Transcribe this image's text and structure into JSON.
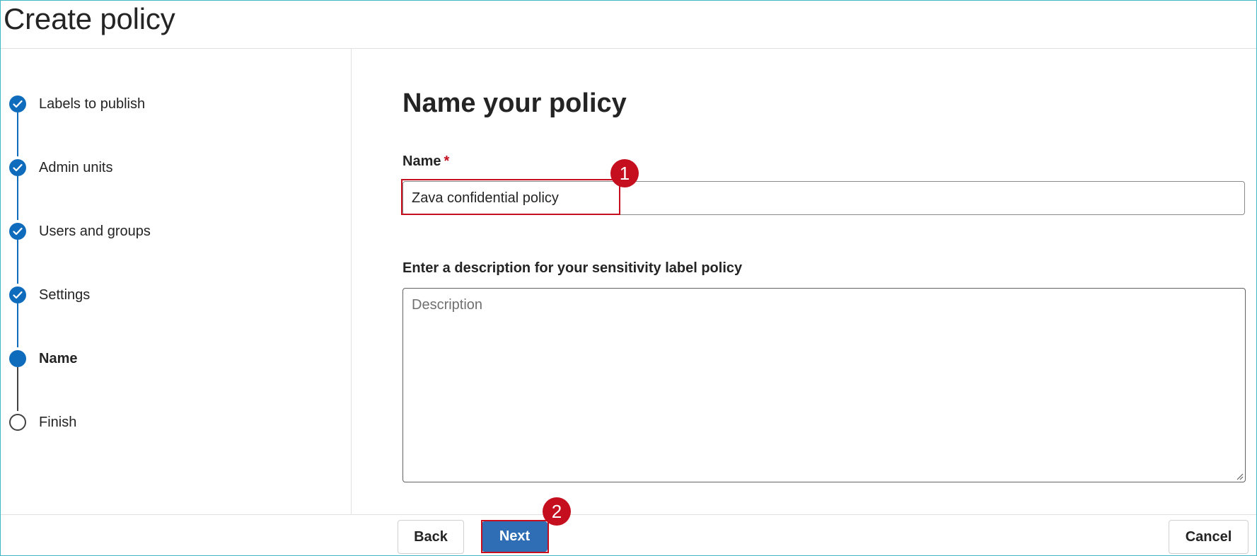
{
  "header": {
    "title": "Create policy"
  },
  "stepper": {
    "steps": [
      {
        "label": "Labels to publish",
        "state": "completed"
      },
      {
        "label": "Admin units",
        "state": "completed"
      },
      {
        "label": "Users and groups",
        "state": "completed"
      },
      {
        "label": "Settings",
        "state": "completed"
      },
      {
        "label": "Name",
        "state": "current"
      },
      {
        "label": "Finish",
        "state": "pending"
      }
    ]
  },
  "main": {
    "heading": "Name your policy",
    "name_field": {
      "label": "Name",
      "required_marker": "*",
      "value": "Zava confidential policy"
    },
    "description_field": {
      "label": "Enter a description for your sensitivity label policy",
      "placeholder": "Description",
      "value": ""
    }
  },
  "annotations": {
    "badge_1": "1",
    "badge_2": "2"
  },
  "footer": {
    "back_label": "Back",
    "next_label": "Next",
    "cancel_label": "Cancel"
  },
  "colors": {
    "accent": "#0f6cbd",
    "primary_button": "#2f6db5",
    "annotation_red": "#c50f1f",
    "frame_border": "#41b6c4"
  },
  "icons": {
    "completed": "checkmark-circle-icon",
    "current": "filled-circle-icon",
    "pending": "empty-circle-icon"
  }
}
